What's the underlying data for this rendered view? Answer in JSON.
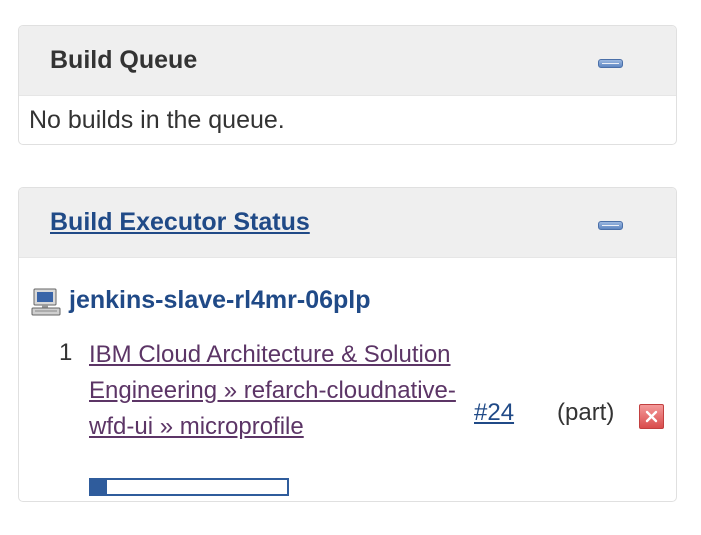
{
  "build_queue": {
    "title": "Build Queue",
    "empty_message": "No builds in the queue."
  },
  "executor_status": {
    "title": "Build Executor Status",
    "node": {
      "name": "jenkins-slave-rl4mr-06plp",
      "icon": "computer-icon"
    },
    "executor": {
      "number": "1",
      "job_name": "IBM Cloud Architecture & Solution Engineering » refarch-cloudnative-wfd-ui » microprofile",
      "build_number": "#24",
      "label": "(part)",
      "progress": 0.08
    }
  },
  "colors": {
    "link_blue": "#204a87",
    "visited_purple": "#5c3566",
    "header_bg": "#efefef",
    "stop_red": "#d94c4c"
  }
}
